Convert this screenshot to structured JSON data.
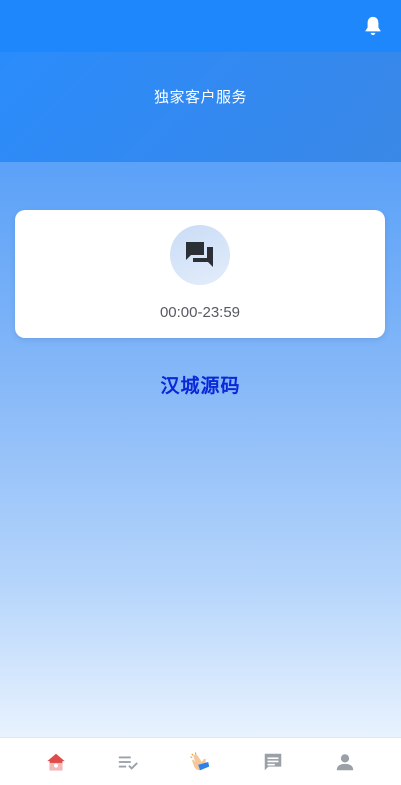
{
  "header": {
    "title": "独家客户服务"
  },
  "service_card": {
    "hours": "00:00-23:59",
    "icon": "chat-bubbles-icon"
  },
  "brand": {
    "text": "汉城源码"
  },
  "nav": {
    "items": [
      {
        "icon": "home-icon",
        "active": true
      },
      {
        "icon": "task-list-icon",
        "active": false
      },
      {
        "icon": "clap-hand-icon",
        "active": false
      },
      {
        "icon": "message-icon",
        "active": false
      },
      {
        "icon": "user-icon",
        "active": false
      }
    ]
  },
  "colors": {
    "top_bar": "#1d87fb",
    "brand_text": "#0a28d8",
    "nav_inactive": "#9aa0a8",
    "home_active": "#e14a4a"
  }
}
